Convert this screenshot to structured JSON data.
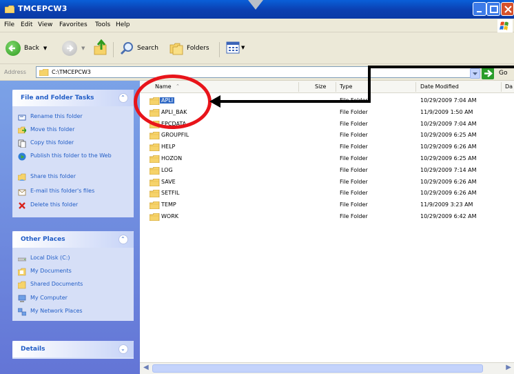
{
  "window": {
    "title": "TMCEPCW3",
    "min_label": "",
    "max_label": "",
    "close_label": ""
  },
  "menu": [
    "File",
    "Edit",
    "View",
    "Favorites",
    "Tools",
    "Help"
  ],
  "toolbar": {
    "back_label": "Back",
    "search_label": "Search",
    "folders_label": "Folders"
  },
  "address": {
    "label": "Address",
    "value": "C:\\TMCEPCW3",
    "go_label": "Go"
  },
  "tasks_panel": {
    "title": "File and Folder Tasks",
    "items": [
      "Rename this folder",
      "Move this folder",
      "Copy this folder",
      "Publish this folder to the Web",
      "Share this folder",
      "E-mail this folder's files",
      "Delete this folder"
    ]
  },
  "other_places": {
    "title": "Other Places",
    "items": [
      "Local Disk (C:)",
      "My Documents",
      "Shared Documents",
      "My Computer",
      "My Network Places"
    ]
  },
  "details": {
    "title": "Details"
  },
  "columns": {
    "name": "Name",
    "size": "Size",
    "type": "Type",
    "date": "Date Modified",
    "extra": "Da"
  },
  "files": [
    {
      "name": "APLI",
      "type": "File Folder",
      "date": "10/29/2009 7:04 AM",
      "selected": true
    },
    {
      "name": "APLI_BAK",
      "type": "File Folder",
      "date": "11/9/2009 1:50 AM"
    },
    {
      "name": "EPCDATA",
      "type": "File Folder",
      "date": "10/29/2009 7:04 AM"
    },
    {
      "name": "GROUPFIL",
      "type": "File Folder",
      "date": "10/29/2009 6:25 AM"
    },
    {
      "name": "HELP",
      "type": "File Folder",
      "date": "10/29/2009 6:26 AM"
    },
    {
      "name": "HOZON",
      "type": "File Folder",
      "date": "10/29/2009 6:25 AM"
    },
    {
      "name": "LOG",
      "type": "File Folder",
      "date": "10/29/2009 7:14 AM"
    },
    {
      "name": "SAVE",
      "type": "File Folder",
      "date": "10/29/2009 6:26 AM"
    },
    {
      "name": "SETFIL",
      "type": "File Folder",
      "date": "10/29/2009 6:26 AM"
    },
    {
      "name": "TEMP",
      "type": "File Folder",
      "date": "11/9/2009 3:23 AM"
    },
    {
      "name": "WORK",
      "type": "File Folder",
      "date": "10/29/2009 6:42 AM"
    }
  ],
  "colors": {
    "titlebar": "#0b3fb0",
    "taskpane_link": "#215dc6",
    "selection": "#316ac5",
    "annotation_red": "#e8141a"
  }
}
